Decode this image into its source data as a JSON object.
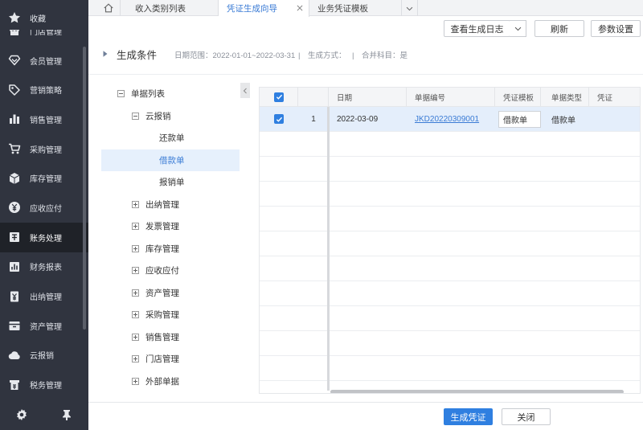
{
  "colors": {
    "sidebar_bg": "#30343f",
    "sidebar_active_bg": "#1f2228",
    "accent": "#2f7fe0",
    "link": "#3a7bd5",
    "selected_row_bg": "#e4eefb"
  },
  "sidebar": {
    "favorite": {
      "label": "收藏",
      "icon": "star-icon"
    },
    "items": [
      {
        "label": "门店管理",
        "icon": "store-icon",
        "active": false
      },
      {
        "label": "会员管理",
        "icon": "diamond-icon",
        "active": false
      },
      {
        "label": "营销策略",
        "icon": "tag-icon",
        "active": false
      },
      {
        "label": "销售管理",
        "icon": "bar-chart-icon",
        "active": false
      },
      {
        "label": "采购管理",
        "icon": "cart-icon",
        "active": false
      },
      {
        "label": "库存管理",
        "icon": "cube-icon",
        "active": false
      },
      {
        "label": "应收应付",
        "icon": "coin-icon",
        "active": false
      },
      {
        "label": "账务处理",
        "icon": "ledger-icon",
        "active": true
      },
      {
        "label": "财务报表",
        "icon": "report-icon",
        "active": false
      },
      {
        "label": "出纳管理",
        "icon": "cashier-icon",
        "active": false
      },
      {
        "label": "资产管理",
        "icon": "asset-icon",
        "active": false
      },
      {
        "label": "云报销",
        "icon": "cloud-icon",
        "active": false
      },
      {
        "label": "税务管理",
        "icon": "tax-icon",
        "active": false
      }
    ],
    "footer_icons": [
      "gear-icon",
      "pin-icon"
    ]
  },
  "tabs": {
    "home_icon": "home-icon",
    "items": [
      {
        "label": "收入类别列表",
        "active": false
      },
      {
        "label": "凭证生成向导",
        "active": true,
        "closable": true
      },
      {
        "label": "业务凭证模板",
        "active": false
      }
    ],
    "more_icon": "chevron-down-icon"
  },
  "toolbar": {
    "log_label": "查看生成日志",
    "refresh_label": "刷新",
    "settings_label": "参数设置"
  },
  "conditions": {
    "title": "生成条件",
    "date_range": "日期范围：2022-01-01~2022-03-31",
    "separator": "|",
    "mode": "生成方式：",
    "merge": "合并科目：是"
  },
  "tree": {
    "root": {
      "label": "单据列表",
      "expanded": true
    },
    "group": {
      "label": "云报销",
      "expanded": true,
      "children": [
        {
          "label": "还款单",
          "selected": false
        },
        {
          "label": "借款单",
          "selected": true
        },
        {
          "label": "报销单",
          "selected": false
        }
      ]
    },
    "collapsed_groups": [
      {
        "label": "出纳管理"
      },
      {
        "label": "发票管理"
      },
      {
        "label": "库存管理"
      },
      {
        "label": "应收应付"
      },
      {
        "label": "资产管理"
      },
      {
        "label": "采购管理"
      },
      {
        "label": "销售管理"
      },
      {
        "label": "门店管理"
      },
      {
        "label": "外部单据"
      }
    ]
  },
  "grid": {
    "header_checked": true,
    "columns": [
      "日期",
      "单据编号",
      "凭证模板",
      "单据类型",
      "凭证"
    ],
    "rows": [
      {
        "selected": true,
        "checked": true,
        "index": "1",
        "date": "2022-03-09",
        "doc_no": "JKD20220309001",
        "template": "借款单",
        "doc_type": "借款单",
        "voucher": ""
      }
    ]
  },
  "footer": {
    "generate_label": "生成凭证",
    "close_label": "关闭"
  }
}
